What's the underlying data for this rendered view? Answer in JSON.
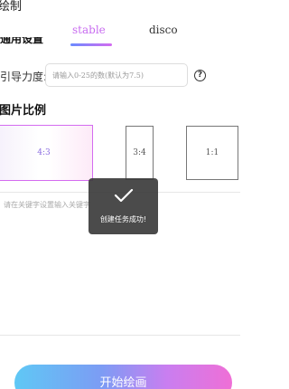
{
  "header": {
    "title": "绘制"
  },
  "tabs": [
    {
      "label": "stable",
      "active": true
    },
    {
      "label": "disco",
      "active": false
    }
  ],
  "settings": {
    "guidance_label": "引导力度:",
    "guidance_placeholder": "请输入0-25的数(默认为7.5)",
    "help_icon": "?"
  },
  "ratio": {
    "heading": "图片比例",
    "options": [
      {
        "label": "4:3",
        "selected": true
      },
      {
        "label": "3:4",
        "selected": false
      },
      {
        "label": "1:1",
        "selected": false
      }
    ]
  },
  "prompt": {
    "hint": "请在关键字设置输入关键字"
  },
  "toast": {
    "message": "创建任务成功!",
    "icon": "check-icon"
  },
  "footer": {
    "start_button": "开始绘画"
  },
  "colors": {
    "accent_start": "#5fc8f5",
    "accent_end": "#ef6fd6",
    "active_tab": "#c86cf0"
  }
}
